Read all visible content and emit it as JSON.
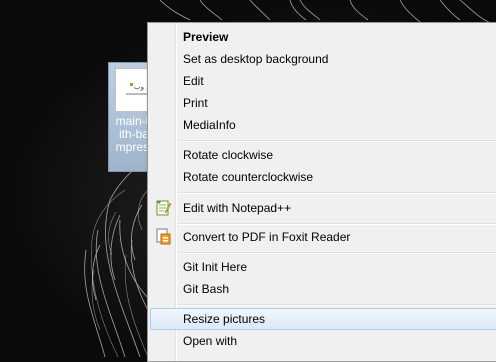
{
  "desktop_icon": {
    "caption": "main-lo\nith-bac\nmpress\ng",
    "logo_text": "إذل وب"
  },
  "context_menu": {
    "items": [
      {
        "label": "Preview",
        "bold": true
      },
      {
        "label": "Set as desktop background"
      },
      {
        "label": "Edit"
      },
      {
        "label": "Print"
      },
      {
        "label": "MediaInfo"
      },
      {
        "label": "Rotate clockwise"
      },
      {
        "label": "Rotate counterclockwise"
      },
      {
        "label": "Edit with Notepad++",
        "icon": "notepad-plus-plus-icon"
      },
      {
        "label": "Convert to PDF in Foxit Reader",
        "icon": "foxit-reader-icon"
      },
      {
        "label": "Git Init Here"
      },
      {
        "label": "Git Bash"
      },
      {
        "label": "Resize pictures",
        "highlighted": true
      },
      {
        "label": "Open with"
      }
    ]
  },
  "colors": {
    "menu_background": "#f0f0f0",
    "highlight": "#dbe9f8",
    "highlight_border": "#aeccf0",
    "icon_selection": "#9fb4cc"
  }
}
